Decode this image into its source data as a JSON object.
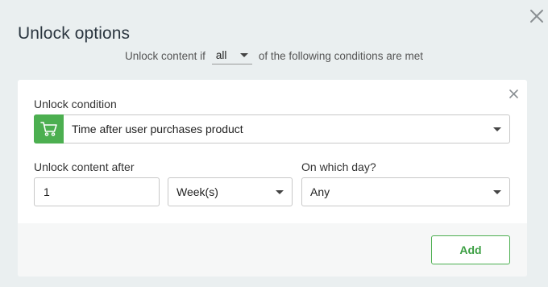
{
  "dialog": {
    "title": "Unlock options",
    "rule": {
      "prefix": "Unlock content if",
      "match_value": "all",
      "suffix": "of the following conditions are met"
    }
  },
  "condition": {
    "label": "Unlock condition",
    "icon": "cart-icon",
    "selected": "Time after user purchases product",
    "accent_color": "#4caf50"
  },
  "delay": {
    "after_label": "Unlock content after",
    "amount": "1",
    "unit": "Week(s)",
    "day_label": "On which day?",
    "day": "Any"
  },
  "footer": {
    "add_label": "Add"
  }
}
